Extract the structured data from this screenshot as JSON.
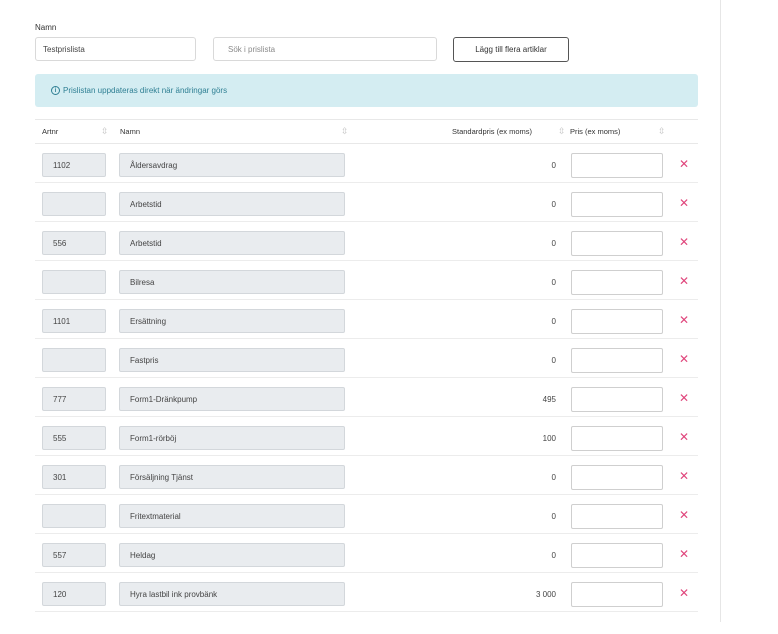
{
  "form": {
    "name_label": "Namn",
    "name_value": "Testprislista",
    "search_placeholder": "Sök i prislista",
    "add_button_label": "Lägg till flera artiklar"
  },
  "info": {
    "icon": "info-icon",
    "text": "Prislistan uppdateras direkt när ändringar görs"
  },
  "table": {
    "headers": {
      "artnr": "Artnr",
      "name": "Namn",
      "standard_price": "Standardpris (ex moms)",
      "price": "Pris (ex moms)"
    },
    "rows": [
      {
        "artnr": "1102",
        "name": "Åldersavdrag",
        "standard_price": "0",
        "price": ""
      },
      {
        "artnr": "",
        "name": "Arbetstid",
        "standard_price": "0",
        "price": ""
      },
      {
        "artnr": "556",
        "name": "Arbetstid",
        "standard_price": "0",
        "price": ""
      },
      {
        "artnr": "",
        "name": "Bilresa",
        "standard_price": "0",
        "price": ""
      },
      {
        "artnr": "1101",
        "name": "Ersättning",
        "standard_price": "0",
        "price": ""
      },
      {
        "artnr": "",
        "name": "Fastpris",
        "standard_price": "0",
        "price": ""
      },
      {
        "artnr": "777",
        "name": "Form1-Dränkpump",
        "standard_price": "495",
        "price": ""
      },
      {
        "artnr": "555",
        "name": "Form1-rörböj",
        "standard_price": "100",
        "price": ""
      },
      {
        "artnr": "301",
        "name": "Försäljning Tjänst",
        "standard_price": "0",
        "price": ""
      },
      {
        "artnr": "",
        "name": "Fritextmaterial",
        "standard_price": "0",
        "price": ""
      },
      {
        "artnr": "557",
        "name": "Heldag",
        "standard_price": "0",
        "price": ""
      },
      {
        "artnr": "120",
        "name": "Hyra lastbil ink provbänk",
        "standard_price": "3 000",
        "price": ""
      }
    ]
  },
  "colors": {
    "info_background": "#d4edf2",
    "info_text": "#2e7f93",
    "delete_icon": "#e0467c"
  }
}
